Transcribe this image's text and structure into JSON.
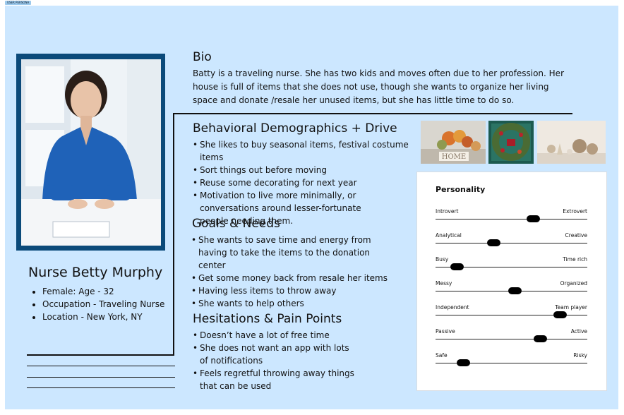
{
  "tag": "USER PERSONA",
  "persona": {
    "name": "Nurse Betty Murphy",
    "facts": [
      "Female: Age - 32",
      "Occupation - Traveling Nurse",
      "Location - New York, NY"
    ]
  },
  "bio": {
    "title": "Bio",
    "text": "Batty is a traveling nurse. She has two kids and moves often due to her profession. Her house is full of items that she does not use, though she wants to organize her living space and donate /resale her unused items, but she has little time to do so."
  },
  "behavioral": {
    "title": "Behavioral Demographics + Drive",
    "items": [
      "She likes to buy seasonal items, festival costume items",
      "Sort things out before moving",
      "Reuse some decorating for next year",
      "Motivation to live more minimally, or conversations around lesser-fortunate people needing them."
    ]
  },
  "goals": {
    "title": "Goals & Needs",
    "items": [
      "She wants to save time and energy from having to take the items to the donation center",
      "Get some money back from resale her items",
      "Having less items to throw away",
      "She wants to help others"
    ]
  },
  "hesitations": {
    "title": "Hesitations & Pain Points",
    "items": [
      "Doesn’t have a lot of free time",
      "She does not want an app with lots of notifications",
      "Feels regretful throwing away things that can be used"
    ]
  },
  "images": {
    "img1_text": "HOME"
  },
  "personality": {
    "title": "Personality",
    "traits": [
      {
        "left": "Introvert",
        "right": "Extrovert",
        "value": 0.64
      },
      {
        "left": "Analytical",
        "right": "Creative",
        "value": 0.38
      },
      {
        "left": "Busy",
        "right": "Time rich",
        "value": 0.14
      },
      {
        "left": "Messy",
        "right": "Organized",
        "value": 0.52
      },
      {
        "left": "Independent",
        "right": "Team player",
        "value": 0.82
      },
      {
        "left": "Passive",
        "right": "Active",
        "value": 0.69
      },
      {
        "left": "Safe",
        "right": "Risky",
        "value": 0.18
      }
    ]
  },
  "colors": {
    "background": "#cce7ff",
    "photo_border": "#0b4a7a",
    "scrub_blue": "#1f62b8"
  }
}
